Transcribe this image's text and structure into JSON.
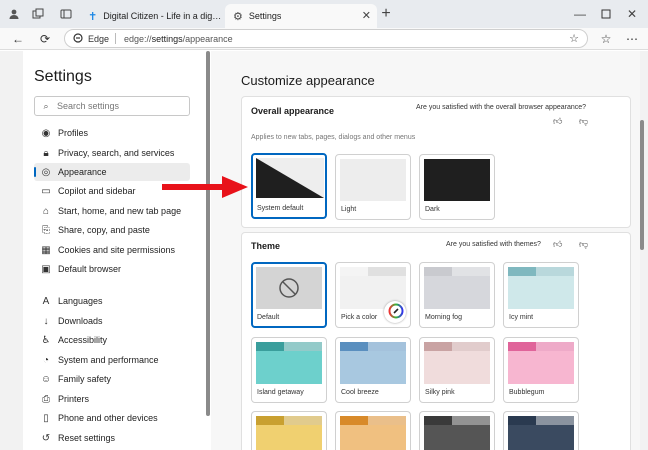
{
  "browser": {
    "tabs": [
      {
        "title": "Digital Citizen - Life in a digital w",
        "icon": "cross-logo-icon"
      },
      {
        "title": "Settings",
        "icon": "gear-icon"
      }
    ],
    "address": {
      "brand": "Edge",
      "url_prefix": "edge://",
      "url_host": "settings",
      "url_path": "/appearance"
    }
  },
  "sidebar": {
    "title": "Settings",
    "search_placeholder": "Search settings",
    "items": [
      {
        "label": "Profiles",
        "icon": "profile-icon"
      },
      {
        "label": "Privacy, search, and services",
        "icon": "lock-icon"
      },
      {
        "label": "Appearance",
        "icon": "palette-icon",
        "selected": true
      },
      {
        "label": "Copilot and sidebar",
        "icon": "sidebar-icon"
      },
      {
        "label": "Start, home, and new tab page",
        "icon": "home-icon"
      },
      {
        "label": "Share, copy, and paste",
        "icon": "share-icon"
      },
      {
        "label": "Cookies and site permissions",
        "icon": "cookie-icon"
      },
      {
        "label": "Default browser",
        "icon": "browser-icon"
      },
      {
        "label": "Languages",
        "icon": "language-icon"
      },
      {
        "label": "Downloads",
        "icon": "download-icon"
      },
      {
        "label": "Accessibility",
        "icon": "accessibility-icon"
      },
      {
        "label": "System and performance",
        "icon": "system-icon"
      },
      {
        "label": "Family safety",
        "icon": "family-icon"
      },
      {
        "label": "Printers",
        "icon": "printer-icon"
      },
      {
        "label": "Phone and other devices",
        "icon": "phone-icon"
      },
      {
        "label": "Reset settings",
        "icon": "reset-icon"
      }
    ]
  },
  "main": {
    "title": "Customize appearance",
    "overall": {
      "heading": "Overall appearance",
      "question": "Are you satisfied with the overall browser appearance?",
      "subtitle": "Applies to new tabs, pages, dialogs and other menus",
      "options": [
        {
          "label": "System default",
          "selected": true
        },
        {
          "label": "Light"
        },
        {
          "label": "Dark"
        }
      ]
    },
    "theme": {
      "heading": "Theme",
      "question": "Are you satisfied with themes?",
      "options": [
        {
          "label": "Default",
          "selected": true
        },
        {
          "label": "Pick a color"
        },
        {
          "label": "Morning fog",
          "colors": [
            "#c9cacf",
            "#d6d7dc"
          ]
        },
        {
          "label": "Icy mint",
          "colors": [
            "#7fb8bf",
            "#cfe8ea"
          ]
        },
        {
          "label": "Island getaway",
          "colors": [
            "#3a9e9c",
            "#6dd0cc"
          ]
        },
        {
          "label": "Cool breeze",
          "colors": [
            "#5a8fbf",
            "#a8c8e0"
          ]
        },
        {
          "label": "Silky pink",
          "colors": [
            "#c9a3a3",
            "#f0dcdc"
          ]
        },
        {
          "label": "Bubblegum",
          "colors": [
            "#e0649a",
            "#f7b6d0"
          ]
        },
        {
          "colors": [
            "#c9a030",
            "#f0d070"
          ]
        },
        {
          "colors": [
            "#d88a2a",
            "#f0c080"
          ]
        },
        {
          "colors": [
            "#3a3a3a",
            "#555555"
          ]
        },
        {
          "colors": [
            "#2a3a50",
            "#3a4a60"
          ]
        }
      ]
    }
  }
}
